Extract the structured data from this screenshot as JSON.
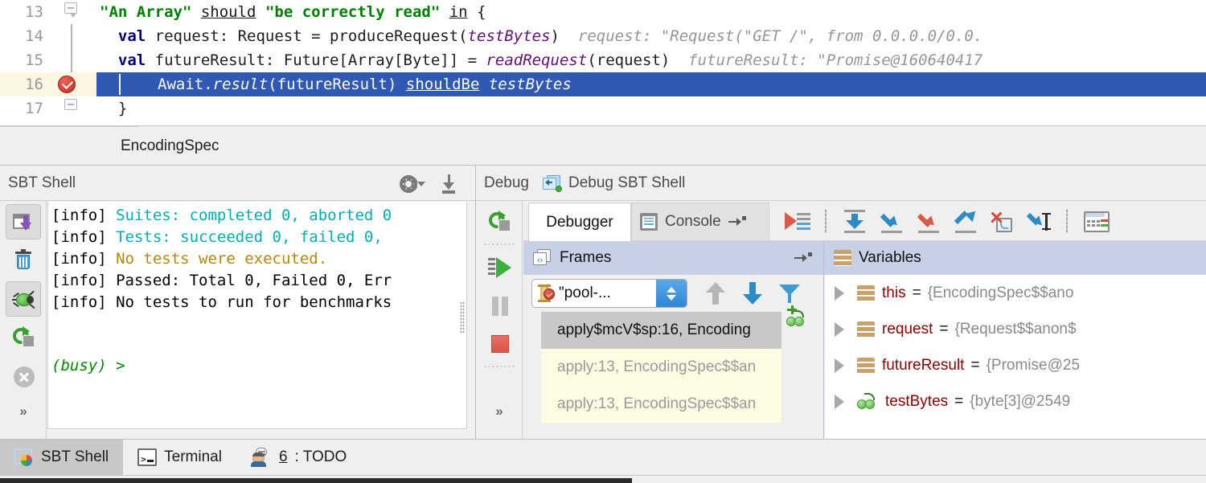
{
  "editor": {
    "lines": [
      {
        "number": "13",
        "gutter": "fold-collapse",
        "segments": [
          {
            "text": "\"An Array\"",
            "style": "str"
          },
          {
            "text": " ",
            "style": "plain"
          },
          {
            "text": "should",
            "style": "under"
          },
          {
            "text": " ",
            "style": "plain"
          },
          {
            "text": "\"be correctly read\"",
            "style": "str"
          },
          {
            "text": " ",
            "style": "plain"
          },
          {
            "text": "in",
            "style": "under"
          },
          {
            "text": " {",
            "style": "plain"
          }
        ]
      },
      {
        "number": "14",
        "gutter": "fold-line",
        "code_plain": "  val request: Request = produceRequest(testBytes)",
        "hint": "request: \"Request(\"GET /\", from 0.0.0.0/0.0."
      },
      {
        "number": "15",
        "gutter": "fold-line",
        "code_plain": "  val futureResult: Future[Array[Byte]] = readRequest(request)",
        "hint": "futureResult: \"Promise@160640417"
      },
      {
        "number": "16",
        "gutter": "breakpoint",
        "selected": true,
        "code_plain": "  Await.result(futureResult) shouldBe testBytes"
      },
      {
        "number": "17",
        "gutter": "fold-end",
        "code_plain": "}"
      }
    ],
    "line13_prefix_spaces": "",
    "line14_kw": "val",
    "line14_rest": " request: Request = produceRequest(",
    "line14_param": "testBytes",
    "line14_tail": ")",
    "line14_hint": "request: \"Request(\"GET /\", from 0.0.0.0/0.0.",
    "line15_kw": "val",
    "line15_rest": " futureResult: Future[Array[Byte]] = ",
    "line15_param": "readRequest",
    "line15_tail": "(request)",
    "line15_hint": "futureResult: \"Promise@160640417",
    "line16_a": "Await.",
    "line16_b": "result",
    "line16_c": "(futureResult) ",
    "line16_d": "shouldBe",
    "line16_e": " ",
    "line16_f": "testBytes",
    "line17": "}"
  },
  "filetab": {
    "label": "EncodingSpec"
  },
  "sbt_panel": {
    "title": "SBT Shell",
    "gear_icon": "gear-icon",
    "download_icon": "download-icon",
    "toolbar": [
      {
        "name": "export-to-file-button",
        "icon": "export-icon"
      },
      {
        "name": "clear-all-button",
        "icon": "trash-icon"
      },
      {
        "name": "debug-button",
        "icon": "bug-icon"
      },
      {
        "name": "restart-button",
        "icon": "rerun-icon"
      },
      {
        "name": "stop-button",
        "icon": "stop-circle-icon"
      },
      {
        "name": "more-button",
        "icon": "chevron-double-right-icon"
      }
    ],
    "console_lines": [
      {
        "prefix": "[info] ",
        "text": "Suites: completed 0, aborted 0",
        "color": "cyan"
      },
      {
        "prefix": "[info] ",
        "text": "Tests: succeeded 0, failed 0,",
        "color": "cyan"
      },
      {
        "prefix": "[info] ",
        "text": "No tests were executed.",
        "color": "gold"
      },
      {
        "prefix": "[info] ",
        "text": "Passed: Total 0, Failed 0, Err",
        "color": "black"
      },
      {
        "prefix": "[info] ",
        "text": "No tests to run for benchmarks",
        "color": "black"
      }
    ],
    "prompt": "(busy) >"
  },
  "debug_panel": {
    "title": "Debug",
    "config_icon": "debug-config-icon",
    "config_name": "Debug SBT Shell",
    "left_toolbar": [
      {
        "name": "rerun-button",
        "icon": "rerun-icon"
      },
      {
        "name": "resume-program-button",
        "icon": "resume-icon"
      },
      {
        "name": "pause-program-button",
        "icon": "pause-icon"
      },
      {
        "name": "stop-button",
        "icon": "stop-square-icon"
      },
      {
        "name": "more-button",
        "icon": "chevron-double-right-icon"
      }
    ],
    "tabs": [
      {
        "label": "Debugger",
        "active": true,
        "icon": null
      },
      {
        "label": "Console",
        "active": false,
        "icon": "console-icon"
      }
    ],
    "pin_icon": "pin-tab-icon",
    "actions": [
      {
        "name": "show-execution-point-button",
        "icon": "show-execution-point-icon"
      },
      {
        "name": "step-over-button",
        "icon": "step-over-icon"
      },
      {
        "name": "step-into-button",
        "icon": "step-into-icon"
      },
      {
        "name": "force-step-into-button",
        "icon": "force-step-into-icon"
      },
      {
        "name": "step-out-button",
        "icon": "step-out-icon"
      },
      {
        "name": "drop-frame-button",
        "icon": "drop-frame-icon"
      },
      {
        "name": "run-to-cursor-button",
        "icon": "run-to-cursor-icon"
      },
      {
        "name": "evaluate-expression-button",
        "icon": "evaluate-expression-icon"
      }
    ],
    "frames": {
      "header": "Frames",
      "header_icon": "frames-icon",
      "pin_icon": "settings-pin-icon",
      "thread_selector": {
        "icon": "thread-suspended-icon",
        "value": "\"pool-..."
      },
      "frame_actions": [
        {
          "name": "move-up-button",
          "icon": "arrow-up-icon"
        },
        {
          "name": "move-down-button",
          "icon": "arrow-down-icon"
        },
        {
          "name": "filter-button",
          "icon": "filter-icon"
        }
      ],
      "items": [
        {
          "label": "apply$mcV$sp:16, Encoding",
          "selected": true
        },
        {
          "label": "apply:13, EncodingSpec$$an",
          "selected": false
        },
        {
          "label": "apply:13, EncodingSpec$$an",
          "selected": false
        }
      ],
      "side_icons": [
        {
          "name": "collapse-button",
          "icon": "minus-icon"
        },
        {
          "name": "scroll-up-button",
          "icon": "triangle-up-icon"
        },
        {
          "name": "more-button",
          "icon": "chevron-double-right-icon"
        }
      ]
    },
    "variables": {
      "header": "Variables",
      "header_icon": "variables-icon",
      "add-watch-icon": "add-watch-icon",
      "items": [
        {
          "icon": "object-icon",
          "name": "this",
          "eq": "=",
          "value": "{EncodingSpec$$ano"
        },
        {
          "icon": "object-icon",
          "name": "request",
          "eq": "=",
          "value": "{Request$$anon$"
        },
        {
          "icon": "object-icon",
          "name": "futureResult",
          "eq": "=",
          "value": "{Promise@25"
        },
        {
          "icon": "array-icon",
          "name": "testBytes",
          "eq": "=",
          "value": "{byte[3]@2549"
        }
      ]
    }
  },
  "bottom_bar": {
    "tabs": [
      {
        "label": "SBT Shell",
        "icon": "sbt-shell-icon",
        "active": true,
        "num": ""
      },
      {
        "label": "Terminal",
        "icon": "terminal-icon",
        "active": false,
        "num": ""
      },
      {
        "label": ": TODO",
        "icon": "todo-icon",
        "active": false,
        "num": "6"
      }
    ]
  },
  "colors": {
    "selection_blue": "#3059b4",
    "current_line": "#fdf6e3",
    "panel_bg": "#efefef",
    "header_blue": "#c7d0e5",
    "string_green": "#008000",
    "keyword_navy": "#000080",
    "param_purple": "#660e7a",
    "hint_gray": "#969696",
    "cyan": "#00b0b0",
    "gold": "#b8860b",
    "var_red": "#8b0000",
    "value_gray": "#8a8a8a"
  }
}
